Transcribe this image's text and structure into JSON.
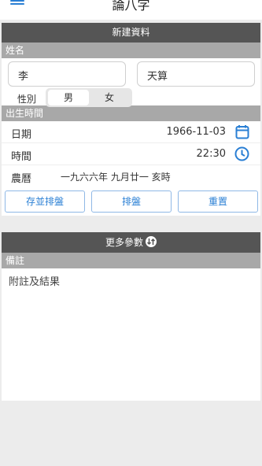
{
  "app": {
    "title": "論八字"
  },
  "new_record": {
    "header": "新建資料",
    "name_section": "姓名",
    "surname_value": "李",
    "given_name_value": "天算",
    "gender_label": "性別",
    "gender_options": [
      "男",
      "女"
    ],
    "gender_selected": "男"
  },
  "birth": {
    "section": "出生時間",
    "date_label": "日期",
    "date_value": "1966-11-03",
    "time_label": "時間",
    "time_value": "22:30",
    "lunar_label": "農曆",
    "lunar_value": "一九六六年 九月廿一 亥時"
  },
  "actions": {
    "save_and_chart": "存並排盤",
    "chart": "排盤",
    "reset": "重置"
  },
  "more": {
    "header": "更多參數",
    "remark_section": "備註",
    "remark_placeholder": "附註及結果"
  },
  "colors": {
    "accent": "#2a7fd4",
    "header_bg": "#555555",
    "label_bg": "#a8a8a8"
  }
}
